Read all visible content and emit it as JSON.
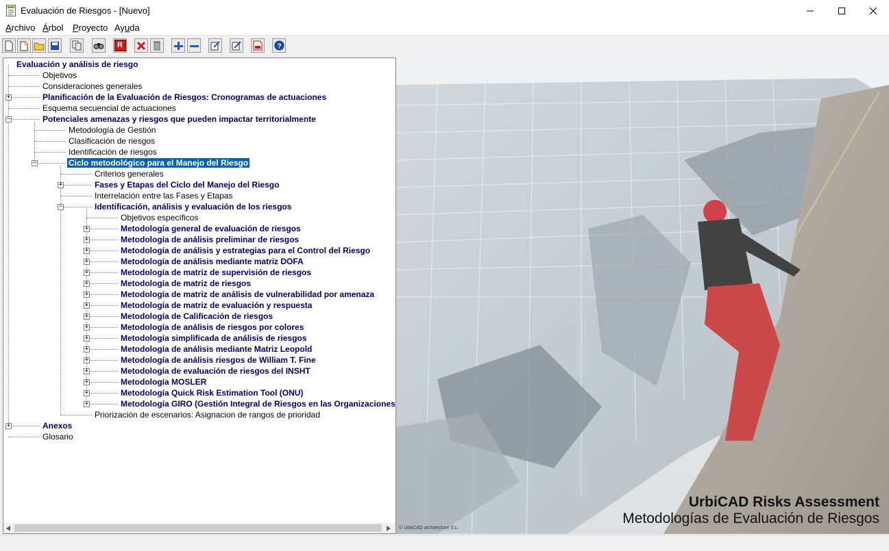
{
  "window": {
    "title": "Evaluación de Riesgos - [Nuevo]"
  },
  "menu": [
    {
      "label": "Archivo",
      "key": "A",
      "rest": "rchivo"
    },
    {
      "label": "Árbol",
      "key": "Á",
      "rest": "rbol"
    },
    {
      "label": "Proyecto",
      "key": "P",
      "rest": "royecto"
    },
    {
      "label": "Ayuda",
      "key": "u",
      "pre": "Ay",
      "rest": "da"
    }
  ],
  "toolbar": {
    "buttons": [
      "new-icon",
      "wand-icon",
      "open-icon",
      "save-icon",
      "copy-icon",
      "find-icon",
      "report-r-icon",
      "delete-icon",
      "trash-icon",
      "expand-all-icon",
      "collapse-all-icon",
      "edit-node-icon",
      "edit-icon",
      "pdf-icon",
      "help-icon"
    ],
    "report_label": "R"
  },
  "tree": {
    "root": "Evaluación y análisis de riesgo",
    "nodes": [
      {
        "label": "Objetivos",
        "bold": false,
        "level": 1,
        "expander": ""
      },
      {
        "label": "Consideraciones generales",
        "bold": false,
        "level": 1,
        "expander": ""
      },
      {
        "label": "Planificación de la Evaluación de Riesgos: Cronogramas de actuaciones",
        "bold": true,
        "level": 1,
        "expander": "+"
      },
      {
        "label": "Esquema secuencial de actuaciones",
        "bold": false,
        "level": 1,
        "expander": ""
      },
      {
        "label": "Potenciales amenazas y riesgos que pueden impactar territorialmente",
        "bold": true,
        "level": 1,
        "expander": "-"
      },
      {
        "label": "Metodología de Gestión",
        "bold": false,
        "level": 2,
        "expander": ""
      },
      {
        "label": "Clasificación de riesgos",
        "bold": false,
        "level": 2,
        "expander": ""
      },
      {
        "label": "Identificación de riesgos",
        "bold": false,
        "level": 2,
        "expander": ""
      },
      {
        "label": "Ciclo metodológico para el Manejo del Riesgo",
        "bold": true,
        "level": 2,
        "expander": "-",
        "selected": true
      },
      {
        "label": "Criterios generales",
        "bold": false,
        "level": 3,
        "expander": ""
      },
      {
        "label": "Fases y Etapas del Ciclo del Manejo del Riesgo",
        "bold": true,
        "level": 3,
        "expander": "+"
      },
      {
        "label": "Interrelación entre las Fases y Etapas",
        "bold": false,
        "level": 3,
        "expander": ""
      },
      {
        "label": "Identificación, análisis y evaluación de los riesgos",
        "bold": true,
        "level": 3,
        "expander": "-"
      },
      {
        "label": "Objetivos específicos",
        "bold": false,
        "level": 4,
        "expander": ""
      },
      {
        "label": "Metodología general de evaluación de riesgos",
        "bold": true,
        "level": 4,
        "expander": "+"
      },
      {
        "label": "Metodología de análisis preliminar de riesgos",
        "bold": true,
        "level": 4,
        "expander": "+"
      },
      {
        "label": "Metodología de análisis y estrategias para el Control del Riesgo",
        "bold": true,
        "level": 4,
        "expander": "+"
      },
      {
        "label": "Metodología de análisis mediante matriz DOFA",
        "bold": true,
        "level": 4,
        "expander": "+"
      },
      {
        "label": "Metodología de matriz de supervisión de riesgos",
        "bold": true,
        "level": 4,
        "expander": "+"
      },
      {
        "label": "Metodología de matriz de riesgos",
        "bold": true,
        "level": 4,
        "expander": "+"
      },
      {
        "label": "Metodología de matriz de análisis de vulnerabilidad por amenaza",
        "bold": true,
        "level": 4,
        "expander": "+"
      },
      {
        "label": "Metodología de matriz de evaluación y respuesta",
        "bold": true,
        "level": 4,
        "expander": "+"
      },
      {
        "label": "Metodología de Calificación de riesgos",
        "bold": true,
        "level": 4,
        "expander": "+"
      },
      {
        "label": "Metodología de análisis de riesgos por colores",
        "bold": true,
        "level": 4,
        "expander": "+"
      },
      {
        "label": "Metodología simplificada de análisis de riesgos",
        "bold": true,
        "level": 4,
        "expander": "+"
      },
      {
        "label": "Metodología de análisis mediante Matriz Leopold",
        "bold": true,
        "level": 4,
        "expander": "+"
      },
      {
        "label": "Metodología de análisis riesgos de William T. Fine",
        "bold": true,
        "level": 4,
        "expander": "+"
      },
      {
        "label": "Metodología de evaluación de riesgos del INSHT",
        "bold": true,
        "level": 4,
        "expander": "+"
      },
      {
        "label": "Metodología MOSLER",
        "bold": true,
        "level": 4,
        "expander": "+"
      },
      {
        "label": "Metodología Quick Risk Estimation Tool (ONU)",
        "bold": true,
        "level": 4,
        "expander": "+"
      },
      {
        "label": "Metodología GIRO (Gestión Integral de Riesgos en las Organizaciones",
        "bold": true,
        "level": 4,
        "expander": "+"
      },
      {
        "label": "Priorización de escenarios: Asignacion de rangos de prioridad",
        "bold": false,
        "level": 3,
        "expander": ""
      },
      {
        "label": "Anexos",
        "bold": true,
        "level": 1,
        "expander": "+"
      },
      {
        "label": "Glosario",
        "bold": false,
        "level": 1,
        "expander": ""
      }
    ]
  },
  "splash": {
    "brand_title": "UrbiCAD Risks Assessment",
    "brand_subtitle": "Metodologías de Evaluación de Riesgos",
    "copyright": "© UrbiCAD architecture S.L."
  }
}
